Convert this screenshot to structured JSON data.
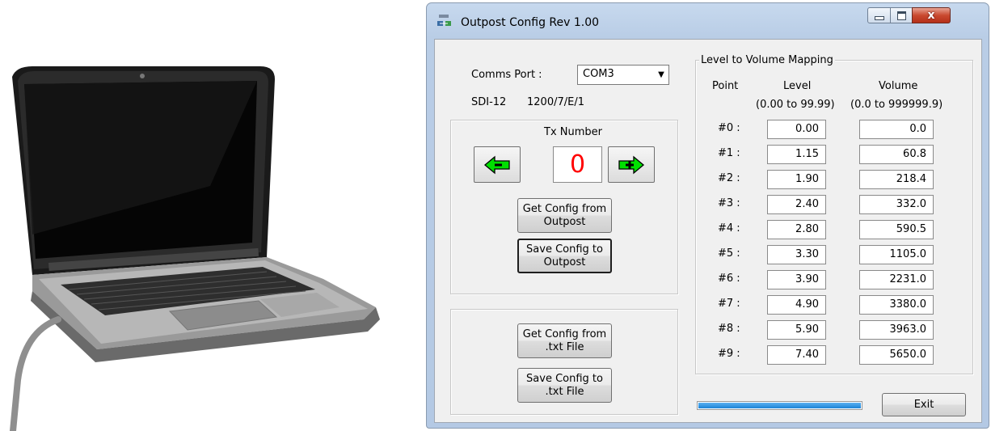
{
  "window": {
    "title": "Outpost Config   Rev 1.00",
    "close_glyph": "x"
  },
  "comms": {
    "port_label": "Comms Port :",
    "port_value": "COM3",
    "sdi_label": "SDI-12",
    "sdi_settings": "1200/7/E/1"
  },
  "tx": {
    "label": "Tx Number",
    "number": "0"
  },
  "buttons": {
    "get_outpost": "Get Config from\nOutpost",
    "save_outpost": "Save Config to\nOutpost",
    "get_file": "Get Config from\n.txt File",
    "save_file": "Save Config to\n.txt File",
    "exit": "Exit"
  },
  "mapping": {
    "group_title": "Level to Volume Mapping",
    "col_point": "Point",
    "col_level": "Level",
    "col_level_range": "(0.00 to 99.99)",
    "col_volume": "Volume",
    "col_volume_range": "(0.0 to 999999.9)",
    "rows": [
      {
        "point": "#0 :",
        "level": "0.00",
        "volume": "0.0"
      },
      {
        "point": "#1 :",
        "level": "1.15",
        "volume": "60.8"
      },
      {
        "point": "#2 :",
        "level": "1.90",
        "volume": "218.4"
      },
      {
        "point": "#3 :",
        "level": "2.40",
        "volume": "332.0"
      },
      {
        "point": "#4 :",
        "level": "2.80",
        "volume": "590.5"
      },
      {
        "point": "#5 :",
        "level": "3.30",
        "volume": "1105.0"
      },
      {
        "point": "#6 :",
        "level": "3.90",
        "volume": "2231.0"
      },
      {
        "point": "#7 :",
        "level": "4.90",
        "volume": "3380.0"
      },
      {
        "point": "#8 :",
        "level": "5.90",
        "volume": "3963.0"
      },
      {
        "point": "#9 :",
        "level": "7.40",
        "volume": "5650.0"
      }
    ]
  },
  "progress": {
    "fraction": 1.0
  },
  "icons": {
    "prev": "arrow-left-minus-icon",
    "next": "arrow-right-plus-icon",
    "combo": "chevron-down-icon",
    "app": "outpost-app-icon"
  },
  "colors": {
    "tx_number": "#ff0000",
    "arrow_green": "#00e000",
    "progress": "#2a8fe0"
  }
}
